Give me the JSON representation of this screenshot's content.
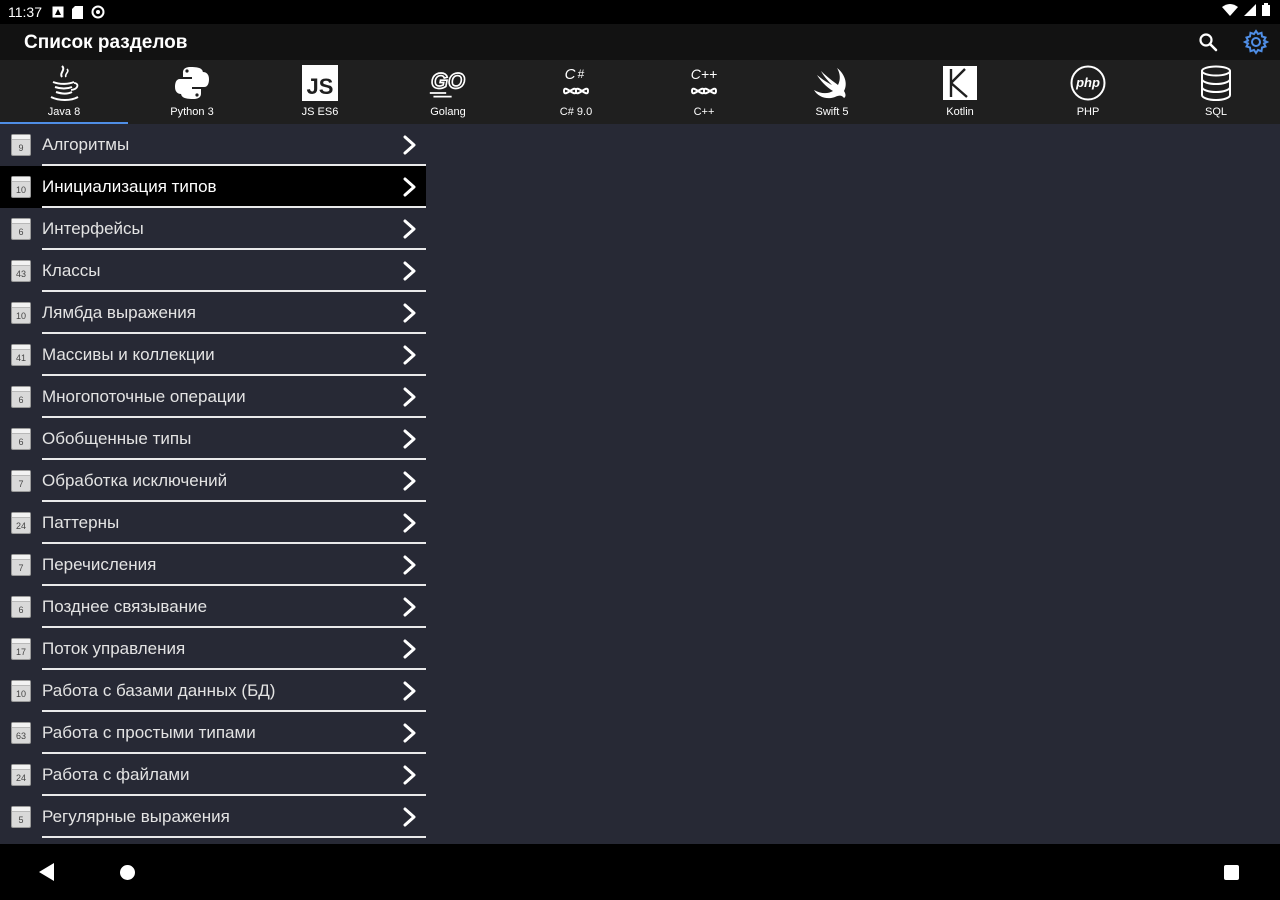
{
  "status_bar": {
    "time": "11:37"
  },
  "app_bar": {
    "title": "Список разделов",
    "accent_color": "#4f8ee6"
  },
  "lang_tabs": [
    {
      "label": "Java 8",
      "icon": "java-icon",
      "active": true
    },
    {
      "label": "Python 3",
      "icon": "python-icon"
    },
    {
      "label": "JS ES6",
      "icon": "js-icon"
    },
    {
      "label": "Golang",
      "icon": "go-icon"
    },
    {
      "label": "C# 9.0",
      "icon": "csharp-icon"
    },
    {
      "label": "C++",
      "icon": "cpp-icon"
    },
    {
      "label": "Swift 5",
      "icon": "swift-icon"
    },
    {
      "label": "Kotlin",
      "icon": "kotlin-icon"
    },
    {
      "label": "PHP",
      "icon": "php-icon"
    },
    {
      "label": "SQL",
      "icon": "sql-icon"
    }
  ],
  "sections": [
    {
      "count": "9",
      "label": "Алгоритмы"
    },
    {
      "count": "10",
      "label": "Инициализация типов",
      "selected": true
    },
    {
      "count": "6",
      "label": "Интерфейсы"
    },
    {
      "count": "43",
      "label": "Классы"
    },
    {
      "count": "10",
      "label": "Лямбда выражения"
    },
    {
      "count": "41",
      "label": "Массивы и коллекции"
    },
    {
      "count": "6",
      "label": "Многопоточные операции"
    },
    {
      "count": "6",
      "label": "Обобщенные типы"
    },
    {
      "count": "7",
      "label": "Обработка исключений"
    },
    {
      "count": "24",
      "label": "Паттерны"
    },
    {
      "count": "7",
      "label": "Перечисления"
    },
    {
      "count": "6",
      "label": "Позднее связывание"
    },
    {
      "count": "17",
      "label": "Поток управления"
    },
    {
      "count": "10",
      "label": "Работа с базами данных (БД)"
    },
    {
      "count": "63",
      "label": "Работа с простыми типами"
    },
    {
      "count": "24",
      "label": "Работа с файлами"
    },
    {
      "count": "5",
      "label": "Регулярные выражения"
    }
  ]
}
